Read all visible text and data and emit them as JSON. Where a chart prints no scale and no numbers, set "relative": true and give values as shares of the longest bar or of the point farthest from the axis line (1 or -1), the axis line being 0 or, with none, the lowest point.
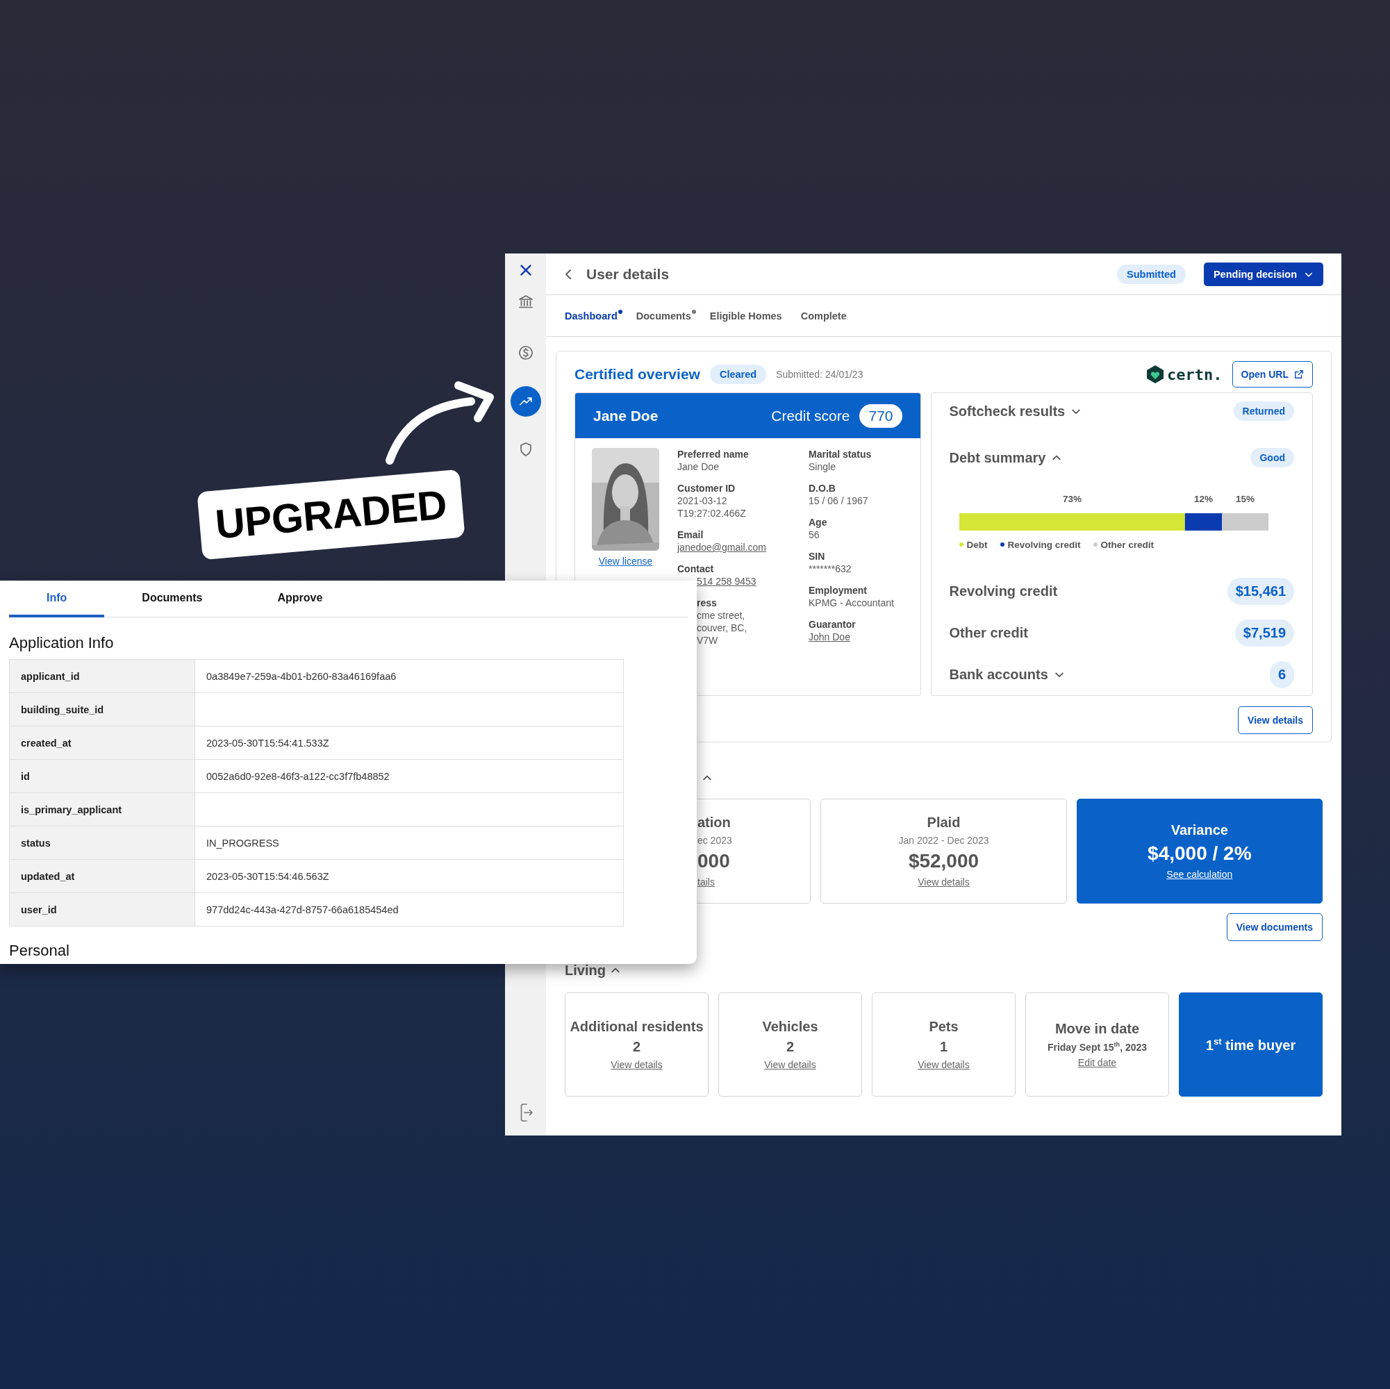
{
  "sticker": {
    "text": "UPGRADED"
  },
  "main_window": {
    "sidebar": [
      {
        "selected": false
      },
      {
        "selected": false
      },
      {
        "selected": true
      },
      {
        "selected": false
      }
    ],
    "title": "User details",
    "status_badge": "Submitted",
    "decision_button": "Pending decision",
    "tabs": [
      {
        "label": "Dashboard",
        "selected": true,
        "dot": true
      },
      {
        "label": "Documents",
        "selected": false,
        "dot": true
      },
      {
        "label": "Eligible Homes",
        "selected": false,
        "dot": false
      },
      {
        "label": "Complete",
        "selected": false,
        "dot": false
      }
    ],
    "certified_overview": {
      "title": "Certified overview",
      "status": "Cleared",
      "submitted": "Submitted: 24/01/23",
      "logo": "certn.",
      "open_url": "Open URL",
      "applicant": {
        "name": "Jane Doe",
        "credit_score_label": "Credit score",
        "credit_score": "770",
        "view_license": "View license",
        "columns": [
          [
            {
              "kind": "text",
              "label": "Preferred name",
              "value": "Jane Doe"
            },
            {
              "kind": "text",
              "label": "Customer ID",
              "value": "2021-03-12\nT19:27:02.466Z"
            },
            {
              "kind": "link",
              "label": "Email",
              "value": "janedoe@gmail.com"
            },
            {
              "kind": "partial_link",
              "label": "Contact",
              "value": "514 258 9453"
            },
            {
              "kind": "partial",
              "label": "ress",
              "value": "cme street,\ncouver, BC,\nV7W"
            }
          ],
          [
            {
              "kind": "text",
              "label": "Marital status",
              "value": "Single"
            },
            {
              "kind": "text",
              "label": "D.O.B",
              "value": "15 / 06 / 1967"
            },
            {
              "kind": "text",
              "label": "Age",
              "value": "56"
            },
            {
              "kind": "text",
              "label": "SIN",
              "value": "*******632"
            },
            {
              "kind": "text",
              "label": "Employment",
              "value": "KPMG - Accountant"
            },
            {
              "kind": "link",
              "label": "Guarantor",
              "value": "John Doe"
            }
          ]
        ]
      },
      "softcheck": {
        "title": "Softcheck results",
        "expanded": false,
        "status": "Returned",
        "debt_summary": {
          "title": "Debt summary",
          "expanded": true,
          "status": "Good",
          "chart_data": {
            "type": "bar",
            "orientation": "horizontal",
            "stacked": true,
            "relative": true,
            "series": [
              {
                "name": "Debt",
                "color": "#d4e636",
                "values": [
                  0.73
                ]
              },
              {
                "name": "Revolving credit",
                "color": "#0a3bb0",
                "values": [
                  0.12
                ]
              },
              {
                "name": "Other credit",
                "color": "#cccccc",
                "values": [
                  0.15
                ]
              }
            ],
            "value_labels": [
              "73%",
              "12%",
              "15%"
            ]
          }
        },
        "totals": [
          {
            "kind": "plain",
            "label": "Revolving credit",
            "value": "$15,461"
          },
          {
            "kind": "plain",
            "label": "Other credit",
            "value": "$7,519"
          },
          {
            "kind": "dropdown",
            "label": "Bank accounts",
            "value": "6"
          }
        ]
      },
      "view_details": "View details"
    },
    "income": {
      "expanded": true,
      "cards": [
        {
          "kind": "partial",
          "title": "ation",
          "period": "ec 2023",
          "amount": "000",
          "link": "tails"
        },
        {
          "kind": "plain",
          "title": "Plaid",
          "period": "Jan 2022 - Dec 2023",
          "amount": "$52,000",
          "link": "View details"
        },
        {
          "kind": "highlight",
          "title": "Variance",
          "amount": "$4,000 / 2%",
          "link": "See calculation"
        }
      ],
      "view_documents": "View documents"
    },
    "living": {
      "title": "Living",
      "expanded": true,
      "cards": [
        {
          "kind": "count",
          "title": "Additional residents",
          "value": "2",
          "link": "View details"
        },
        {
          "kind": "count",
          "title": "Vehicles",
          "value": "2",
          "link": "View details"
        },
        {
          "kind": "count",
          "title": "Pets",
          "value": "1",
          "link": "View details"
        },
        {
          "kind": "date",
          "title": "Move in date",
          "value": "Friday Sept 15$^{th}$, 2023",
          "link": "Edit date"
        },
        {
          "kind": "highlight",
          "title": "1$^{st}$ time buyer"
        }
      ]
    }
  },
  "record_panel": {
    "tabs": [
      {
        "label": "Info",
        "selected": true
      },
      {
        "label": "Documents",
        "selected": false
      },
      {
        "label": "Approve",
        "selected": false
      }
    ],
    "section": "Application Info",
    "rows": [
      {
        "key": "applicant_id",
        "value": "0a3849e7-259a-4b01-b260-83a46169faa6"
      },
      {
        "key": "building_suite_id"
      },
      {
        "key": "created_at",
        "value": "2023-05-30T15:54:41.533Z"
      },
      {
        "key": "id",
        "value": "0052a6d0-92e8-46f3-a122-cc3f7fb48852"
      },
      {
        "key": "is_primary_applicant"
      },
      {
        "key": "status",
        "value": "IN_PROGRESS"
      },
      {
        "key": "updated_at",
        "value": "2023-05-30T15:54:46.563Z"
      },
      {
        "key": "user_id",
        "value": "977dd24c-443a-427d-8757-66a6185454ed"
      }
    ],
    "next_section": "Personal"
  }
}
